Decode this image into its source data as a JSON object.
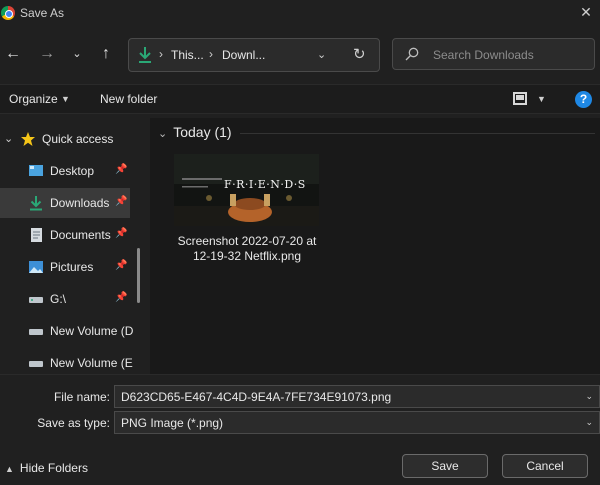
{
  "window": {
    "title": "Save As"
  },
  "address": {
    "crumbs": [
      "This...",
      "Downl..."
    ]
  },
  "search": {
    "placeholder": "Search Downloads"
  },
  "toolbar": {
    "organize_label": "Organize",
    "new_folder_label": "New folder"
  },
  "sidebar": {
    "items": [
      {
        "label": "Quick access",
        "icon": "star-icon"
      },
      {
        "label": "Desktop",
        "icon": "desktop-icon"
      },
      {
        "label": "Downloads",
        "icon": "download-icon"
      },
      {
        "label": "Documents",
        "icon": "document-icon"
      },
      {
        "label": "Pictures",
        "icon": "pictures-icon"
      },
      {
        "label": "G:\\",
        "icon": "drive-icon"
      },
      {
        "label": "New Volume (D",
        "icon": "drive-icon"
      },
      {
        "label": "New Volume (E",
        "icon": "drive-icon"
      }
    ]
  },
  "content": {
    "group": "Today (1)",
    "files": [
      {
        "name": "Screenshot 2022-07-20 at 12-19-32 Netflix.png",
        "thumb_text": "F·R·I·E·N·D·S"
      }
    ]
  },
  "save": {
    "file_name_label": "File name:",
    "file_name": "D623CD65-E467-4C4D-9E4A-7FE734E91073.png",
    "save_as_type_label": "Save as type:",
    "save_as_type": "PNG Image (*.png)",
    "hide_folders_label": "Hide Folders",
    "save_button": "Save",
    "cancel_button": "Cancel"
  },
  "colors": {
    "background": "#202020",
    "accent": "#1e88e5",
    "download_green": "#2aa876",
    "star_yellow": "#f5c518"
  }
}
